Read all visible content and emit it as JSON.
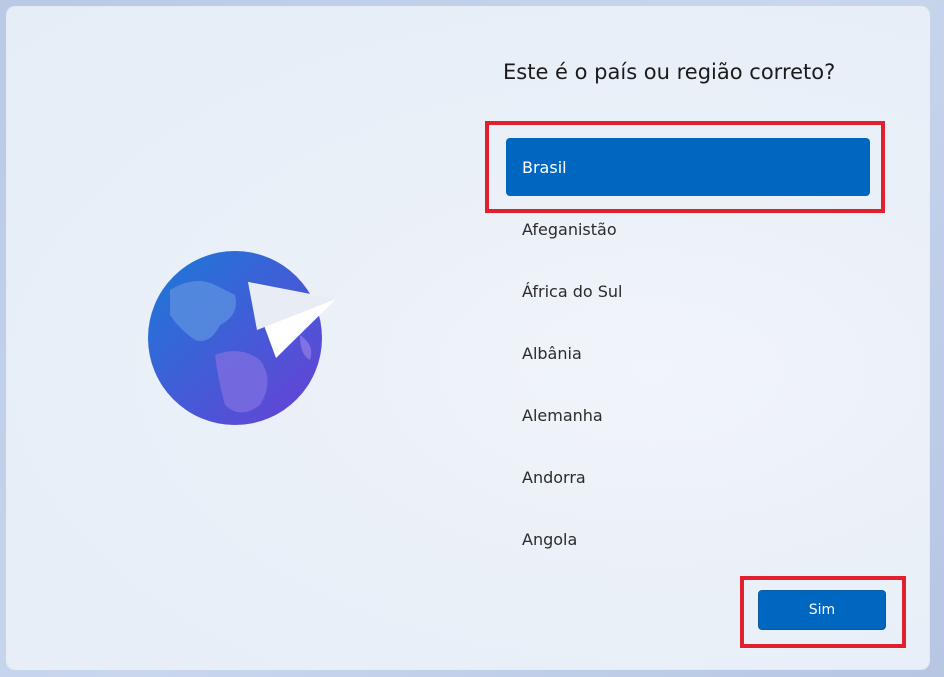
{
  "dialog": {
    "title": "Este é o país ou região correto?"
  },
  "countries": [
    {
      "label": "Brasil",
      "selected": true
    },
    {
      "label": "Afeganistão",
      "selected": false
    },
    {
      "label": "África do Sul",
      "selected": false
    },
    {
      "label": "Albânia",
      "selected": false
    },
    {
      "label": "Alemanha",
      "selected": false
    },
    {
      "label": "Andorra",
      "selected": false
    },
    {
      "label": "Angola",
      "selected": false
    }
  ],
  "actions": {
    "confirm_label": "Sim"
  },
  "icons": {
    "illustration": "globe-paper-plane-icon"
  },
  "colors": {
    "accent": "#0067c0",
    "highlight": "#e0202e"
  }
}
